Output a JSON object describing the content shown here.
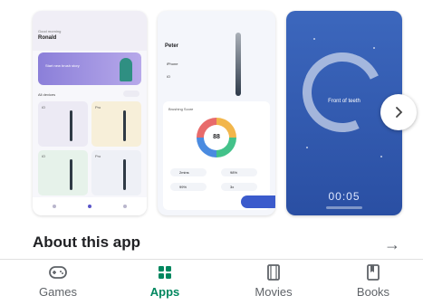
{
  "screenshots": {
    "s1": {
      "greeting_small": "Good morning",
      "greeting_name": "Ronald",
      "banner_text": "Start new brush story",
      "devices_label": "All devices",
      "card_labels": [
        "iO",
        "Pro",
        "iO",
        "Pro"
      ]
    },
    "s2": {
      "user_name": "Peter",
      "device_rows": [
        "iPhone",
        "iO"
      ],
      "score_label": "Brushing Score",
      "score_value": "88",
      "stats": [
        "2mins",
        "98%",
        "99%",
        "3x"
      ]
    },
    "s3": {
      "zone_text": "Front of teeth",
      "timer": "00:05"
    }
  },
  "about": {
    "title": "About this app"
  },
  "nav": {
    "items": [
      {
        "label": "Games",
        "icon": "gamepad-icon"
      },
      {
        "label": "Apps",
        "icon": "apps-grid-icon",
        "active": true
      },
      {
        "label": "Movies",
        "icon": "film-icon"
      },
      {
        "label": "Books",
        "icon": "bookmark-icon"
      }
    ]
  },
  "colors": {
    "accent": "#01875f",
    "screen3_bg": "#3c67bd"
  }
}
